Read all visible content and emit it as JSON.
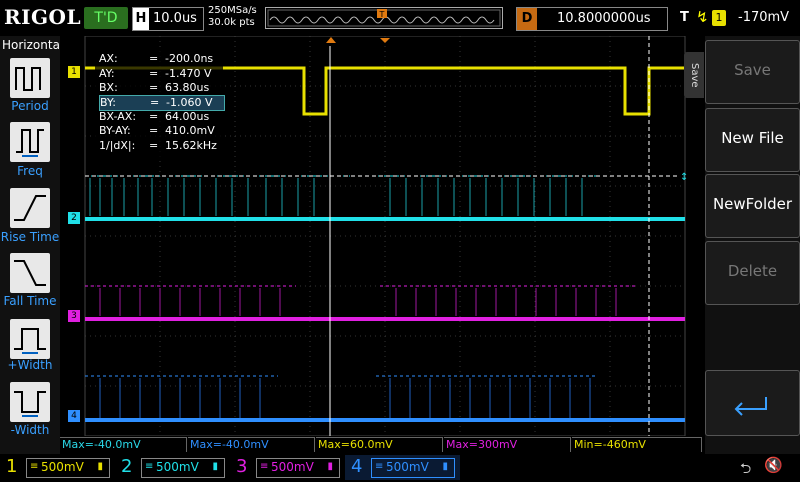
{
  "topbar": {
    "brand": "RIGOL",
    "trigger_mode": "T'D",
    "horizontal_key": "H",
    "timebase": "10.0us",
    "sample_rate": "250MSa/s",
    "memory_depth": "30.0k pts",
    "delay_key": "D",
    "delay_value": "10.8000000us",
    "trigger_key": "T",
    "trigger_slope": "rising-edge-icon",
    "trigger_channel": "1",
    "trigger_level": "-170mV"
  },
  "left_menu": {
    "title": "Horizontal",
    "items": [
      {
        "label": "Period",
        "icon": "period-icon"
      },
      {
        "label": "Freq",
        "icon": "freq-icon"
      },
      {
        "label": "Rise Time",
        "icon": "rise-time-icon"
      },
      {
        "label": "Fall Time",
        "icon": "fall-time-icon"
      },
      {
        "label": "+Width",
        "icon": "positive-width-icon"
      },
      {
        "label": "-Width",
        "icon": "negative-width-icon"
      }
    ]
  },
  "cursor_readout": {
    "rows": [
      {
        "name": "AX:",
        "eq": "=",
        "value": "-200.0ns"
      },
      {
        "name": "AY:",
        "eq": "=",
        "value": "-1.470 V"
      },
      {
        "name": "BX:",
        "eq": "=",
        "value": "63.80us"
      },
      {
        "name": "BY:",
        "eq": "=",
        "value": "-1.060 V"
      },
      {
        "name": "BX-AX:",
        "eq": "=",
        "value": "64.00us"
      },
      {
        "name": "BY-AY:",
        "eq": "=",
        "value": "410.0mV"
      },
      {
        "name": "1/|dX|:",
        "eq": "=",
        "value": "15.62kHz"
      }
    ]
  },
  "channel_markers": [
    "1",
    "2",
    "3",
    "4"
  ],
  "right_panel": {
    "tab": "Save",
    "buttons": [
      {
        "label": "Save",
        "enabled": false
      },
      {
        "label": "New File",
        "enabled": true
      },
      {
        "label": "NewFolder",
        "enabled": true
      },
      {
        "label": "Delete",
        "enabled": false
      }
    ],
    "return_icon": "return-arrow-icon"
  },
  "measurements": [
    {
      "text": "Max=-40.0mV",
      "color": "#2ad8e8"
    },
    {
      "text": "Max=-40.0mV",
      "color": "#2f8fff"
    },
    {
      "text": "Max=60.0mV",
      "color": "#e8e000"
    },
    {
      "text": "Max=300mV",
      "color": "#e020e0"
    },
    {
      "text": "Min=-460mV",
      "color": "#e8e000"
    }
  ],
  "channels": [
    {
      "num": "1",
      "scale": "500mV",
      "color": "#e8e000"
    },
    {
      "num": "2",
      "scale": "500mV",
      "color": "#20e0e8"
    },
    {
      "num": "3",
      "scale": "500mV",
      "color": "#e020e0"
    },
    {
      "num": "4",
      "scale": "500mV",
      "color": "#2f8fff"
    }
  ],
  "status_icons": [
    "usb-icon",
    "speaker-mute-icon"
  ],
  "colors": {
    "ch1": "#e8e000",
    "ch2": "#20e0e8",
    "ch3": "#e020e0",
    "ch4": "#2f8fff",
    "trigger_accent": "#c66a12"
  }
}
